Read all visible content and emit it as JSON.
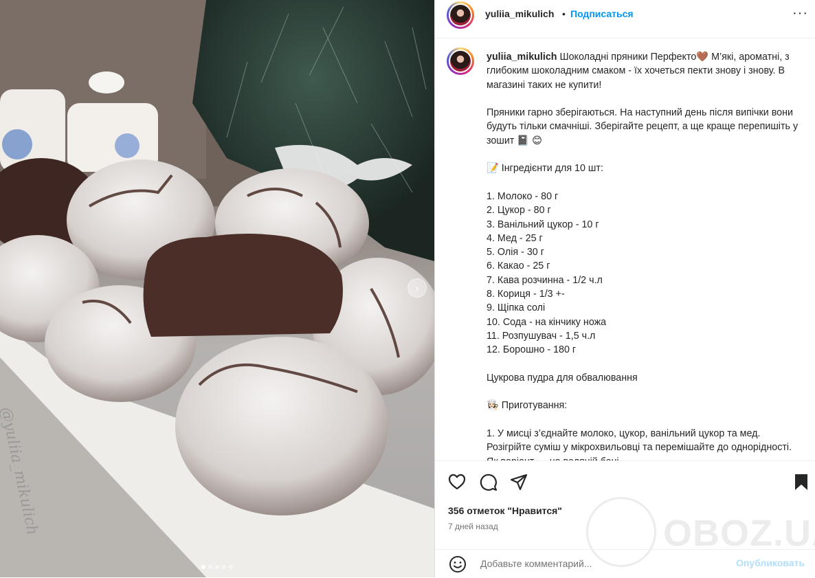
{
  "post": {
    "username": "yuliia_mikulich",
    "separator": "•",
    "follow_label": "Подписаться",
    "more_label": "···"
  },
  "photo": {
    "watermark": "@yuliia_mikulich",
    "carousel_next": "›",
    "slide_count": 5,
    "active_slide": 1
  },
  "caption": {
    "username": "yuliia_mikulich",
    "lines": [
      "Шоколадні пряники Перфекто🤎 М’які, ароматні, з глибоким шоколадним смаком - їх хочеться пекти знову і знову. В магазині таких не купити!",
      "",
      "Пряники гарно зберігаються. На наступний день після випічки вони будуть тільки смачніші. Зберігайте рецепт, а ще краще перепишіть у зошит 📓 😊",
      "",
      "📝 Інгредієнти для 10 шт:",
      "",
      "1. Молоко - 80 г",
      "2. Цукор - 80 г",
      "3. Ванільний цукор - 10 г",
      "4. Мед - 25 г",
      "5. Олія - 30 г",
      "6. Какао - 25 г",
      "7. Кава розчинна - 1/2 ч.л",
      "8. Кориця - 1/3 +-",
      "9. Щіпка солі",
      "10. Сода - на кінчику ножа",
      "11. Розпушувач - 1,5 ч.л",
      "12. Борошно - 180 г",
      "",
      "Цукрова пудра для обвалювання",
      "",
      "👩🏻‍🍳 Приготування:",
      "",
      "1. У мисці з’єднайте молоко, цукор, ванільний цукор та мед. Розігрійте суміш у мікрохвильовці та перемішайте до однорідності. Як варіант — на водяній бані."
    ]
  },
  "actions": {
    "like_icon": "heart-icon",
    "comment_icon": "comment-icon",
    "share_icon": "share-icon",
    "save_icon": "bookmark-icon",
    "likes_text": "356 отметок \"Нравится\"",
    "time_text": "7 дней назад"
  },
  "comment": {
    "emoji_icon": "smiley-icon",
    "placeholder": "Добавьте комментарий...",
    "publish_label": "Опубликовать"
  },
  "watermark": {
    "text": "OBOZ.UA"
  }
}
